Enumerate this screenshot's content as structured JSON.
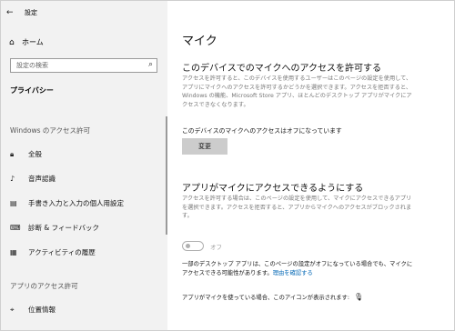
{
  "window": {
    "title": "設定"
  },
  "sidebar": {
    "home_label": "ホーム",
    "search_placeholder": "設定の検索",
    "current_section": "プライバシー",
    "windows_permissions_header": "Windows のアクセス許可",
    "windows_items": [
      {
        "label": "全般",
        "icon": "lock-icon"
      },
      {
        "label": "音声認識",
        "icon": "speech-icon"
      },
      {
        "label": "手書き入力と入力の個人用設定",
        "icon": "clipboard-icon"
      },
      {
        "label": "診断 & フィードバック",
        "icon": "feedback-icon"
      },
      {
        "label": "アクティビティの履歴",
        "icon": "activity-icon"
      }
    ],
    "app_permissions_header": "アプリのアクセス許可",
    "app_items": [
      {
        "label": "位置情報",
        "icon": "location-icon"
      }
    ]
  },
  "main": {
    "title": "マイク",
    "device_section": {
      "heading": "このデバイスでのマイクへのアクセスを許可する",
      "description": "アクセスを許可すると、このデバイスを使用するユーザーはこのページの設定を使用して、アプリにマイクへのアクセスを許可するかどうかを選択できます。アクセスを拒否すると、Windows の機能、Microsoft Store アプリ、ほとんどのデスクトップ アプリがマイクにアクセスできなくなります。",
      "status": "このデバイスのマイクへのアクセスはオフになっています",
      "change_button": "変更"
    },
    "app_section": {
      "heading": "アプリがマイクにアクセスできるようにする",
      "description": "アクセスを許可する場合は、このページの設定を使用して、マイクにアクセスできるアプリを選択できます。アクセスを拒否すると、アプリからマイクへのアクセスがブロックされます。",
      "toggle_state": "オフ",
      "note": "一部のデスクトップ アプリは、このページの設定がオフになっている場合でも、マイクにアクセスできる可能性があります。",
      "link": "理由を確認する",
      "mic_indicator_text": "アプリがマイクを使っている場合、このアイコンが表示されます:"
    }
  },
  "colors": {
    "sidebar_bg": "#f2f2f2",
    "link": "#0066b4",
    "button_bg": "#cccccc"
  }
}
